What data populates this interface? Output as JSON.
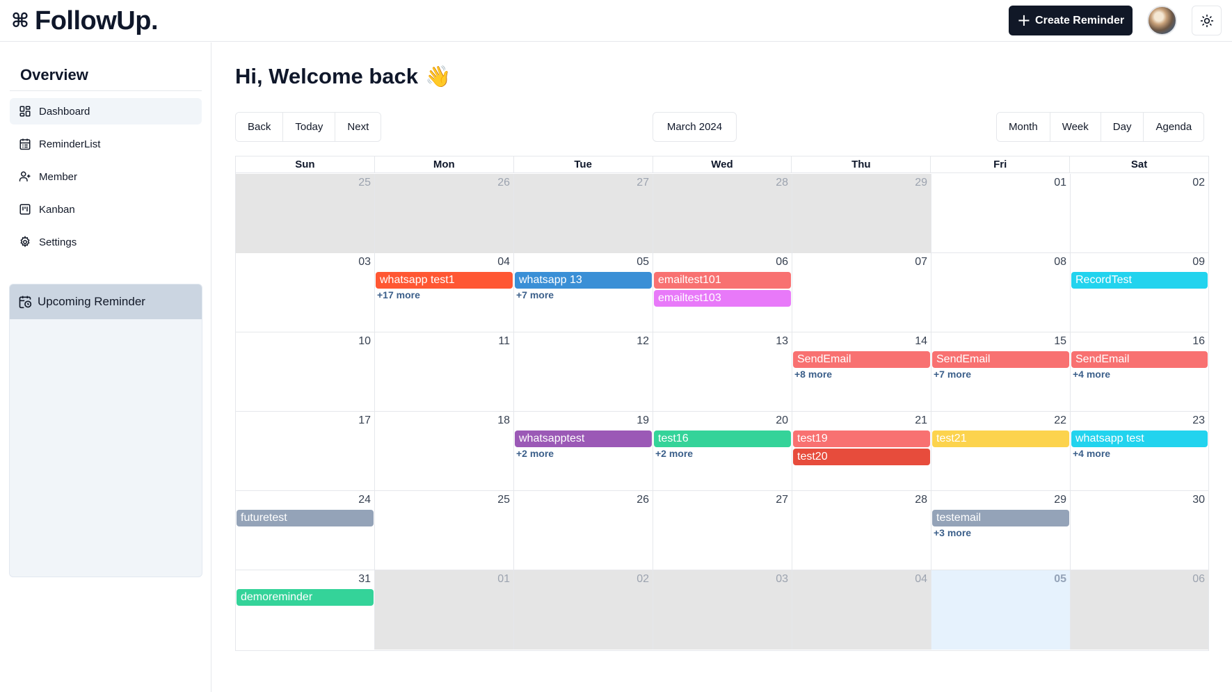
{
  "header": {
    "logo_icon": "⌘",
    "logo_text": "FollowUp.",
    "create_label": "Create Reminder"
  },
  "sidebar": {
    "title": "Overview",
    "items": [
      {
        "label": "Dashboard",
        "icon": "dashboard-icon",
        "active": true
      },
      {
        "label": "ReminderList",
        "icon": "calendar-list-icon",
        "active": false
      },
      {
        "label": "Member",
        "icon": "user-plus-icon",
        "active": false
      },
      {
        "label": "Kanban",
        "icon": "kanban-icon",
        "active": false
      },
      {
        "label": "Settings",
        "icon": "gear-icon",
        "active": false
      }
    ],
    "upcoming_label": "Upcoming Reminder"
  },
  "main": {
    "welcome": "Hi, Welcome back",
    "wave": "👋"
  },
  "toolbar": {
    "nav": [
      "Back",
      "Today",
      "Next"
    ],
    "month_label": "March 2024",
    "views": [
      "Month",
      "Week",
      "Day",
      "Agenda"
    ]
  },
  "calendar": {
    "weekdays": [
      "Sun",
      "Mon",
      "Tue",
      "Wed",
      "Thu",
      "Fri",
      "Sat"
    ],
    "weeks": [
      [
        {
          "d": "25",
          "off": true
        },
        {
          "d": "26",
          "off": true
        },
        {
          "d": "27",
          "off": true
        },
        {
          "d": "28",
          "off": true
        },
        {
          "d": "29",
          "off": true
        },
        {
          "d": "01"
        },
        {
          "d": "02"
        }
      ],
      [
        {
          "d": "03"
        },
        {
          "d": "04",
          "events": [
            {
              "label": "whatsapp test1",
              "color": "#ff5733"
            }
          ],
          "more": "+17 more"
        },
        {
          "d": "05",
          "events": [
            {
              "label": "whatsapp 13",
              "color": "#3a8fd6"
            }
          ],
          "more": "+7 more"
        },
        {
          "d": "06",
          "events": [
            {
              "label": "emailtest101",
              "color": "#f87171"
            },
            {
              "label": "emailtest103",
              "color": "#e879f9"
            }
          ]
        },
        {
          "d": "07"
        },
        {
          "d": "08"
        },
        {
          "d": "09",
          "events": [
            {
              "label": "RecordTest",
              "color": "#22d3ee"
            }
          ]
        }
      ],
      [
        {
          "d": "10"
        },
        {
          "d": "11"
        },
        {
          "d": "12"
        },
        {
          "d": "13"
        },
        {
          "d": "14",
          "events": [
            {
              "label": "SendEmail",
              "color": "#f87171"
            }
          ],
          "more": "+8 more"
        },
        {
          "d": "15",
          "events": [
            {
              "label": "SendEmail",
              "color": "#f87171"
            }
          ],
          "more": "+7 more"
        },
        {
          "d": "16",
          "events": [
            {
              "label": "SendEmail",
              "color": "#f87171"
            }
          ],
          "more": "+4 more"
        }
      ],
      [
        {
          "d": "17"
        },
        {
          "d": "18"
        },
        {
          "d": "19",
          "events": [
            {
              "label": "whatsapptest",
              "color": "#9b59b6"
            }
          ],
          "more": "+2 more"
        },
        {
          "d": "20",
          "events": [
            {
              "label": "test16",
              "color": "#34d399"
            }
          ],
          "more": "+2 more"
        },
        {
          "d": "21",
          "events": [
            {
              "label": "test19",
              "color": "#f87171"
            },
            {
              "label": "test20",
              "color": "#e74c3c"
            }
          ]
        },
        {
          "d": "22",
          "events": [
            {
              "label": "test21",
              "color": "#fcd34d"
            }
          ]
        },
        {
          "d": "23",
          "events": [
            {
              "label": "whatsapp test",
              "color": "#22d3ee"
            }
          ],
          "more": "+4 more"
        }
      ],
      [
        {
          "d": "24",
          "events": [
            {
              "label": "futuretest",
              "color": "#94a3b8"
            }
          ]
        },
        {
          "d": "25"
        },
        {
          "d": "26"
        },
        {
          "d": "27"
        },
        {
          "d": "28"
        },
        {
          "d": "29",
          "events": [
            {
              "label": "testemail",
              "color": "#94a3b8"
            }
          ],
          "more": "+3 more"
        },
        {
          "d": "30"
        }
      ],
      [
        {
          "d": "31",
          "events": [
            {
              "label": "demoreminder",
              "color": "#34d399"
            }
          ]
        },
        {
          "d": "01",
          "off": true
        },
        {
          "d": "02",
          "off": true
        },
        {
          "d": "03",
          "off": true
        },
        {
          "d": "04",
          "off": true
        },
        {
          "d": "05",
          "today": true
        },
        {
          "d": "06",
          "off": true
        }
      ]
    ]
  }
}
